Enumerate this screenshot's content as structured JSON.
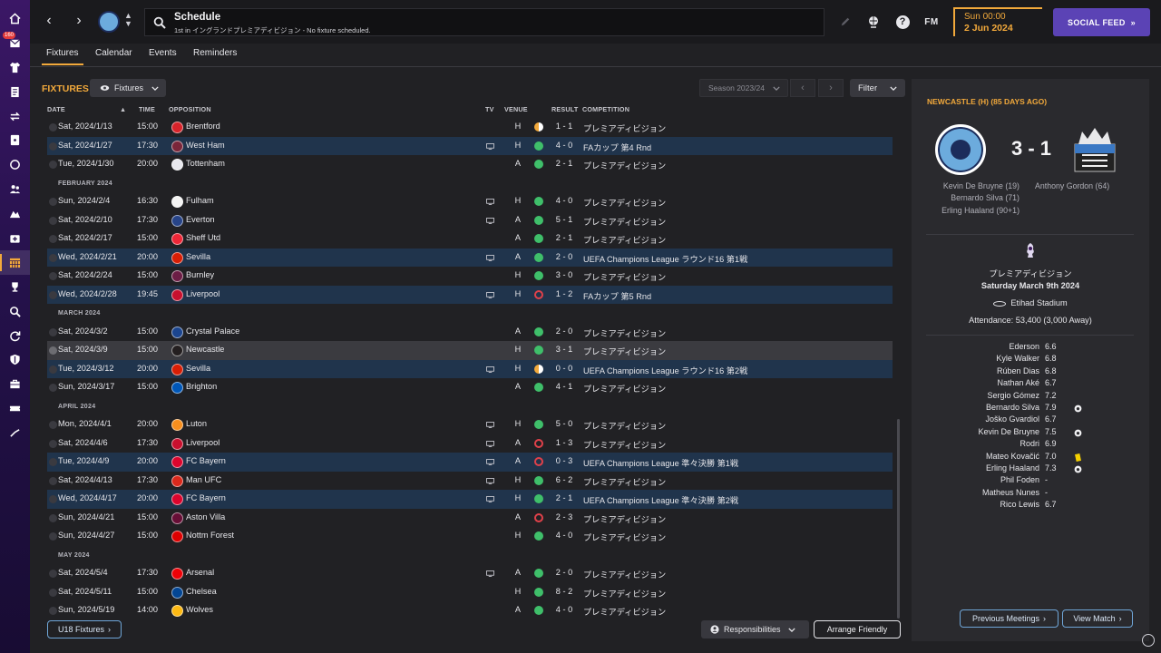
{
  "topbar": {
    "title": "Schedule",
    "subtitle": "1st in イングランドプレミアディビジョン - No fixture scheduled.",
    "fm_logo": "FM",
    "date_time": "Sun 00:00",
    "date": "2 Jun 2024",
    "social_label": "SOCIAL FEED",
    "social_arrow": "»",
    "notification_count": "160"
  },
  "tabs": [
    "Fixtures",
    "Calendar",
    "Events",
    "Reminders"
  ],
  "fixtures": {
    "title": "FIXTURES",
    "view_dropdown": "Fixtures",
    "season": "Season 2023/24",
    "filter": "Filter",
    "columns": {
      "date": "DATE",
      "time": "TIME",
      "opposition": "OPPOSITION",
      "tv": "TV",
      "venue": "VENUE",
      "result": "RESULT",
      "competition": "COMPETITION"
    },
    "rows": [
      {
        "type": "match",
        "date": "Sat, 2024/1/13",
        "time": "15:00",
        "opp": "Brentford",
        "crest": "#d8232a",
        "tv": false,
        "venue": "H",
        "res": "d",
        "score": "1 - 1",
        "comp": "プレミアディビジョン",
        "hl": ""
      },
      {
        "type": "match",
        "date": "Sat, 2024/1/27",
        "time": "17:30",
        "opp": "West Ham",
        "crest": "#7a263a",
        "tv": true,
        "venue": "H",
        "res": "w",
        "score": "4 - 0",
        "comp": "FAカップ 第4 Rnd",
        "hl": "blue"
      },
      {
        "type": "match",
        "date": "Tue, 2024/1/30",
        "time": "20:00",
        "opp": "Tottenham",
        "crest": "#e8e8ee",
        "tv": false,
        "venue": "A",
        "res": "w",
        "score": "2 - 1",
        "comp": "プレミアディビジョン",
        "hl": ""
      },
      {
        "type": "month",
        "label": "FEBRUARY 2024"
      },
      {
        "type": "match",
        "date": "Sun, 2024/2/4",
        "time": "16:30",
        "opp": "Fulham",
        "crest": "#f4f4f4",
        "tv": true,
        "venue": "H",
        "res": "w",
        "score": "4 - 0",
        "comp": "プレミアディビジョン",
        "hl": ""
      },
      {
        "type": "match",
        "date": "Sat, 2024/2/10",
        "time": "17:30",
        "opp": "Everton",
        "crest": "#274488",
        "tv": true,
        "venue": "A",
        "res": "w",
        "score": "5 - 1",
        "comp": "プレミアディビジョン",
        "hl": ""
      },
      {
        "type": "match",
        "date": "Sat, 2024/2/17",
        "time": "15:00",
        "opp": "Sheff Utd",
        "crest": "#ee2737",
        "tv": false,
        "venue": "A",
        "res": "w",
        "score": "2 - 1",
        "comp": "プレミアディビジョン",
        "hl": ""
      },
      {
        "type": "match",
        "date": "Wed, 2024/2/21",
        "time": "20:00",
        "opp": "Sevilla",
        "crest": "#d81e05",
        "tv": true,
        "venue": "A",
        "res": "w",
        "score": "2 - 0",
        "comp": "UEFA Champions League ラウンド16 第1戦",
        "hl": "blue"
      },
      {
        "type": "match",
        "date": "Sat, 2024/2/24",
        "time": "15:00",
        "opp": "Burnley",
        "crest": "#6c1d45",
        "tv": false,
        "venue": "H",
        "res": "w",
        "score": "3 - 0",
        "comp": "プレミアディビジョン",
        "hl": ""
      },
      {
        "type": "match",
        "date": "Wed, 2024/2/28",
        "time": "19:45",
        "opp": "Liverpool",
        "crest": "#c8102e",
        "tv": true,
        "venue": "H",
        "res": "l",
        "score": "1 - 2",
        "comp": "FAカップ 第5 Rnd",
        "hl": "blue"
      },
      {
        "type": "month",
        "label": "MARCH 2024"
      },
      {
        "type": "match",
        "date": "Sat, 2024/3/2",
        "time": "15:00",
        "opp": "Crystal Palace",
        "crest": "#1b458f",
        "tv": false,
        "venue": "A",
        "res": "w",
        "score": "2 - 0",
        "comp": "プレミアディビジョン",
        "hl": ""
      },
      {
        "type": "match",
        "date": "Sat, 2024/3/9",
        "time": "15:00",
        "opp": "Newcastle",
        "crest": "#241f20",
        "tv": false,
        "venue": "H",
        "res": "w",
        "score": "3 - 1",
        "comp": "プレミアディビジョン",
        "hl": "sel",
        "done": true
      },
      {
        "type": "match",
        "date": "Tue, 2024/3/12",
        "time": "20:00",
        "opp": "Sevilla",
        "crest": "#d81e05",
        "tv": true,
        "venue": "H",
        "res": "d",
        "score": "0 - 0",
        "comp": "UEFA Champions League ラウンド16 第2戦",
        "hl": "blue"
      },
      {
        "type": "match",
        "date": "Sun, 2024/3/17",
        "time": "15:00",
        "opp": "Brighton",
        "crest": "#0057b8",
        "tv": false,
        "venue": "A",
        "res": "w",
        "score": "4 - 1",
        "comp": "プレミアディビジョン",
        "hl": ""
      },
      {
        "type": "month",
        "label": "APRIL 2024"
      },
      {
        "type": "match",
        "date": "Mon, 2024/4/1",
        "time": "20:00",
        "opp": "Luton",
        "crest": "#f78f1e",
        "tv": true,
        "venue": "H",
        "res": "w",
        "score": "5 - 0",
        "comp": "プレミアディビジョン",
        "hl": ""
      },
      {
        "type": "match",
        "date": "Sat, 2024/4/6",
        "time": "17:30",
        "opp": "Liverpool",
        "crest": "#c8102e",
        "tv": true,
        "venue": "A",
        "res": "l",
        "score": "1 - 3",
        "comp": "プレミアディビジョン",
        "hl": ""
      },
      {
        "type": "match",
        "date": "Tue, 2024/4/9",
        "time": "20:00",
        "opp": "FC Bayern",
        "crest": "#dc052d",
        "tv": true,
        "venue": "A",
        "res": "l",
        "score": "0 - 3",
        "comp": "UEFA Champions League 準々決勝 第1戦",
        "hl": "blue"
      },
      {
        "type": "match",
        "date": "Sat, 2024/4/13",
        "time": "17:30",
        "opp": "Man UFC",
        "crest": "#da291c",
        "tv": true,
        "venue": "H",
        "res": "w",
        "score": "6 - 2",
        "comp": "プレミアディビジョン",
        "hl": ""
      },
      {
        "type": "match",
        "date": "Wed, 2024/4/17",
        "time": "20:00",
        "opp": "FC Bayern",
        "crest": "#dc052d",
        "tv": true,
        "venue": "H",
        "res": "w",
        "score": "2 - 1",
        "comp": "UEFA Champions League 準々決勝 第2戦",
        "hl": "blue"
      },
      {
        "type": "match",
        "date": "Sun, 2024/4/21",
        "time": "15:00",
        "opp": "Aston Villa",
        "crest": "#670e36",
        "tv": false,
        "venue": "A",
        "res": "l",
        "score": "2 - 3",
        "comp": "プレミアディビジョン",
        "hl": ""
      },
      {
        "type": "match",
        "date": "Sun, 2024/4/27",
        "time": "15:00",
        "opp": "Nottm Forest",
        "crest": "#dd0000",
        "tv": false,
        "venue": "H",
        "res": "w",
        "score": "4 - 0",
        "comp": "プレミアディビジョン",
        "hl": ""
      },
      {
        "type": "month",
        "label": "MAY 2024"
      },
      {
        "type": "match",
        "date": "Sat, 2024/5/4",
        "time": "17:30",
        "opp": "Arsenal",
        "crest": "#ef0107",
        "tv": true,
        "venue": "A",
        "res": "w",
        "score": "2 - 0",
        "comp": "プレミアディビジョン",
        "hl": ""
      },
      {
        "type": "match",
        "date": "Sat, 2024/5/11",
        "time": "15:00",
        "opp": "Chelsea",
        "crest": "#034694",
        "tv": false,
        "venue": "H",
        "res": "w",
        "score": "8 - 2",
        "comp": "プレミアディビジョン",
        "hl": ""
      },
      {
        "type": "match",
        "date": "Sun, 2024/5/19",
        "time": "14:00",
        "opp": "Wolves",
        "crest": "#fdb913",
        "tv": false,
        "venue": "A",
        "res": "w",
        "score": "4 - 0",
        "comp": "プレミアディビジョン",
        "hl": ""
      }
    ],
    "u18_label": "U18 Fixtures",
    "responsibilities_label": "Responsibilities",
    "arrange_label": "Arrange Friendly"
  },
  "match_panel": {
    "title": "NEWCASTLE (H) (85 DAYS AGO)",
    "score": "3 - 1",
    "home_scorers": [
      "Kevin De Bruyne (19)",
      "Bernardo Silva (71)",
      "Erling Haaland (90+1)"
    ],
    "away_scorers": [
      "Anthony Gordon (64)"
    ],
    "competition": "プレミアディビジョン",
    "date": "Saturday March 9th 2024",
    "stadium": "Etihad Stadium",
    "attendance": "Attendance: 53,400 (3,000 Away)",
    "ratings": [
      {
        "name": "Ederson",
        "rating": "6.6",
        "event": ""
      },
      {
        "name": "Kyle Walker",
        "rating": "6.8",
        "event": ""
      },
      {
        "name": "Rúben Dias",
        "rating": "6.8",
        "event": ""
      },
      {
        "name": "Nathan Aké",
        "rating": "6.7",
        "event": ""
      },
      {
        "name": "Sergio Gómez",
        "rating": "7.2",
        "event": ""
      },
      {
        "name": "Bernardo Silva",
        "rating": "7.9",
        "event": "goal"
      },
      {
        "name": "Joško Gvardiol",
        "rating": "6.7",
        "event": ""
      },
      {
        "name": "Kevin De Bruyne",
        "rating": "7.5",
        "event": "goal"
      },
      {
        "name": "Rodri",
        "rating": "6.9",
        "event": ""
      },
      {
        "name": "Mateo Kovačić",
        "rating": "7.0",
        "event": "yellow"
      },
      {
        "name": "Erling Haaland",
        "rating": "7.3",
        "event": "goal"
      },
      {
        "name": "Phil Foden",
        "rating": "-",
        "event": ""
      },
      {
        "name": "Matheus Nunes",
        "rating": "-",
        "event": ""
      },
      {
        "name": "Rico Lewis",
        "rating": "6.7",
        "event": ""
      }
    ],
    "prev_meetings": "Previous Meetings",
    "view_match": "View Match"
  },
  "colors": {
    "accent": "#f2a93b",
    "social": "#5b43b5",
    "win": "#3fbf6a",
    "loss": "#e0414a",
    "highlight_row": "#20344c"
  }
}
